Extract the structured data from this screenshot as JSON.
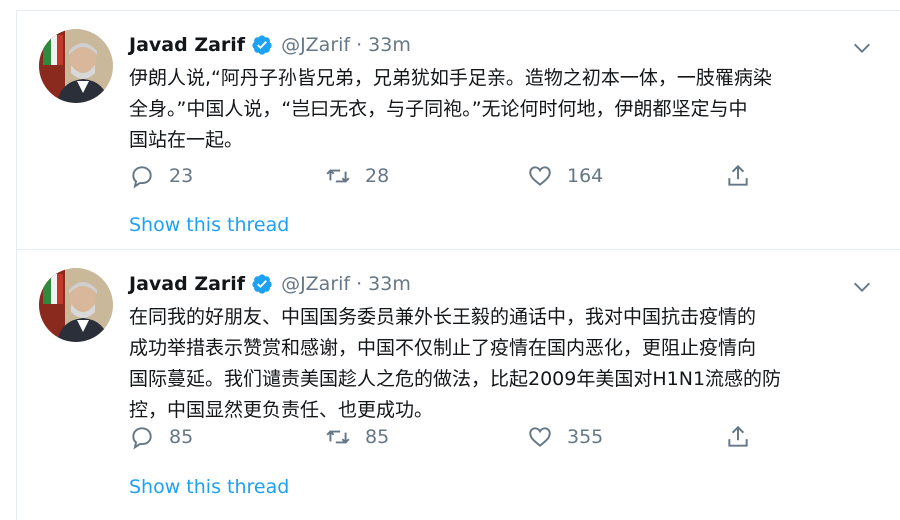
{
  "tweets": [
    {
      "author_name": "Javad Zarif",
      "handle": "@JZarif",
      "separator": "·",
      "time": "33m",
      "text": "伊朗人说,“阿丹子孙皆兄弟，兄弟犹如手足亲。造物之初本一体，一肢罹病染\n全身。”中国人说，“岂曰无衣，与子同袍。”无论何时何地，伊朗都坚定与中\n国站在一起。",
      "replies": "23",
      "retweets": "28",
      "likes": "164",
      "show_thread": "Show this thread"
    },
    {
      "author_name": "Javad Zarif",
      "handle": "@JZarif",
      "separator": "·",
      "time": "33m",
      "text": "在同我的好朋友、中国国务委员兼外长王毅的通话中，我对中国抗击疫情的\n成功举措表示赞赏和感谢，中国不仅制止了疫情在国内恶化，更阻止疫情向\n国际蔓延。我们谴责美国趁人之危的做法，比起2009年美国对H1N1流感的防\n控，中国显然更负责任、也更成功。",
      "replies": "85",
      "retweets": "85",
      "likes": "355",
      "show_thread": "Show this thread"
    }
  ],
  "colors": {
    "accent": "#1da1f2",
    "secondary_text": "#657786",
    "border": "#e6ecf0"
  },
  "icons": [
    "verified-badge-icon",
    "chevron-down-icon",
    "reply-icon",
    "retweet-icon",
    "like-icon",
    "share-icon"
  ]
}
